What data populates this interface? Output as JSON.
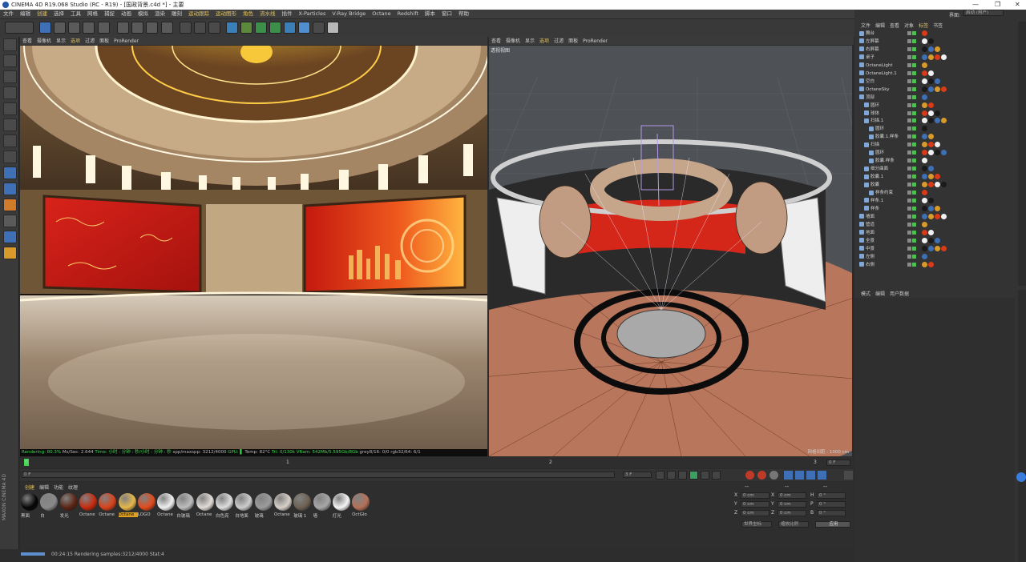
{
  "window": {
    "title": "CINEMA 4D R19.068 Studio (RC - R19) - [国政背景.c4d *] - 主要",
    "controls": [
      "—",
      "❐",
      "✕"
    ]
  },
  "menubar": {
    "items": [
      "文件",
      "编辑",
      "创建",
      "选择",
      "工具",
      "网格",
      "捕捉",
      "动画",
      "模拟",
      "渲染",
      "雕刻",
      "运动跟踪",
      "运动图形",
      "角色",
      "流水线",
      "插件",
      "X-Particles",
      "V-Ray Bridge",
      "Octane",
      "Redshift",
      "脚本",
      "窗口",
      "帮助"
    ],
    "highlighted": [
      "创建",
      "运动跟踪",
      "运动图形",
      "角色",
      "流水线"
    ]
  },
  "layout_selector": {
    "label": "界面:",
    "value": "启动 (用户)"
  },
  "viewport_left": {
    "menu": [
      "查看",
      "摄像机",
      "显示",
      "选项",
      "过滤",
      "面板",
      "ProRender"
    ],
    "render_status": {
      "rendering": "Rendering: 80.3%",
      "ms_sec": "Ms/Sec: 2.644",
      "time": "Time: 小时 : 分钟 : 秒/小时 : 分钟 : 秒",
      "spp": "spp/maxspp: 3212/4000",
      "gpu": "GPU: ▌",
      "temp": "Temp: 82°C",
      "tri": "Tri: 0/130k",
      "vram": "VRam: 542Mb/5.595Gb/8Gb",
      "grey": "grey8/16: 0/0",
      "rgb": "rgb32/64: 6/1"
    }
  },
  "viewport_right": {
    "menu": [
      "查看",
      "摄像机",
      "显示",
      "选项",
      "过滤",
      "面板",
      "ProRender"
    ],
    "label": "透视视图",
    "grid_info": "网格间距 : 1000 cm"
  },
  "timeline": {
    "ticks": [
      "0",
      "1",
      "2",
      "3"
    ],
    "current": "0 F",
    "start_field": "0 F",
    "end_field": "3 F"
  },
  "material_manager": {
    "menu": [
      "创建",
      "编辑",
      "功能",
      "纹理"
    ],
    "materials": [
      {
        "name": "黑面",
        "color": "#050505"
      },
      {
        "name": "白",
        "color": "#8a8a8a"
      },
      {
        "name": "发光",
        "color": "#5b2413"
      },
      {
        "name": "Octane",
        "color": "#c82a0e"
      },
      {
        "name": "Octane",
        "color": "#d9421a"
      },
      {
        "name": "Octane",
        "color": "#e6b84a"
      },
      {
        "name": "LOGO",
        "color": "#e24a1b"
      },
      {
        "name": "Octane",
        "color": "#f0f0f0"
      },
      {
        "name": "白玻璃",
        "color": "#bdbdbd"
      },
      {
        "name": "Octane",
        "color": "#e2dcd8"
      },
      {
        "name": "白色亮",
        "color": "#dedede"
      },
      {
        "name": "白地面",
        "color": "#cdcdcd"
      },
      {
        "name": "玻璃",
        "color": "#9c9c9c"
      },
      {
        "name": "Octane",
        "color": "#d8d0c8"
      },
      {
        "name": "玻璃 1",
        "color": "#6d6152"
      },
      {
        "name": "墙",
        "color": "#a7a7a7"
      },
      {
        "name": "灯光",
        "color": "#f5f5f5"
      },
      {
        "name": "OctGlo",
        "color": "#b47158"
      }
    ],
    "selected_index": 5
  },
  "coordinates": {
    "header": [
      "--",
      "--",
      "--"
    ],
    "rows": [
      {
        "axis": "X",
        "pos": "0 cm",
        "axis2": "X",
        "size": "0 cm",
        "axis3": "H",
        "rot": "0 °"
      },
      {
        "axis": "Y",
        "pos": "0 cm",
        "axis2": "Y",
        "size": "0 cm",
        "axis3": "P",
        "rot": "0 °"
      },
      {
        "axis": "Z",
        "pos": "0 cm",
        "axis2": "Z",
        "size": "0 cm",
        "axis3": "B",
        "rot": "0 °"
      }
    ],
    "mode1": "世界坐标",
    "mode2": "缩放比例",
    "apply": "应用"
  },
  "statusbar": {
    "text": "00:24:15 Rendering samples:3212/4000 Stat:4"
  },
  "object_manager": {
    "menu": [
      "文件",
      "编辑",
      "查看",
      "对象",
      "标签",
      "书签"
    ],
    "objects": [
      {
        "name": "舞台",
        "indent": 0
      },
      {
        "name": "左屏幕",
        "indent": 0
      },
      {
        "name": "右屏幕",
        "indent": 0
      },
      {
        "name": "桌子",
        "indent": 0
      },
      {
        "name": "OctaneLight",
        "indent": 0
      },
      {
        "name": "OctaneLight.1",
        "indent": 0
      },
      {
        "name": "空白",
        "indent": 0
      },
      {
        "name": "OctaneSky",
        "indent": 0
      },
      {
        "name": "顶部",
        "indent": 0
      },
      {
        "name": "圆环",
        "indent": 1
      },
      {
        "name": "球体",
        "indent": 1
      },
      {
        "name": "扫描.1",
        "indent": 1
      },
      {
        "name": "圆环",
        "indent": 2
      },
      {
        "name": "胶囊.1.样条",
        "indent": 2
      },
      {
        "name": "扫描",
        "indent": 1
      },
      {
        "name": "圆环",
        "indent": 2
      },
      {
        "name": "胶囊.样条",
        "indent": 2
      },
      {
        "name": "细分曲面",
        "indent": 1
      },
      {
        "name": "胶囊.1",
        "indent": 1
      },
      {
        "name": "胶囊",
        "indent": 1
      },
      {
        "name": "样条约束",
        "indent": 2
      },
      {
        "name": "样条.1",
        "indent": 1
      },
      {
        "name": "样条",
        "indent": 1
      },
      {
        "name": "墙面",
        "indent": 0
      },
      {
        "name": "管道",
        "indent": 0
      },
      {
        "name": "地面",
        "indent": 0
      },
      {
        "name": "全景",
        "indent": 0
      },
      {
        "name": "中景",
        "indent": 0
      },
      {
        "name": "左侧",
        "indent": 0
      },
      {
        "name": "右侧",
        "indent": 0
      }
    ]
  },
  "attribute_manager": {
    "menu": [
      "模式",
      "编辑",
      "用户数据"
    ]
  },
  "side_tabs": [
    "对象",
    "场次",
    "内容浏览器",
    "构造"
  ],
  "maxon_logo": "MAXON CINEMA 4D",
  "colors": {
    "accent": "#e3c261",
    "render_green": "#3ed64c",
    "selection_blue": "#3f6fb4"
  }
}
